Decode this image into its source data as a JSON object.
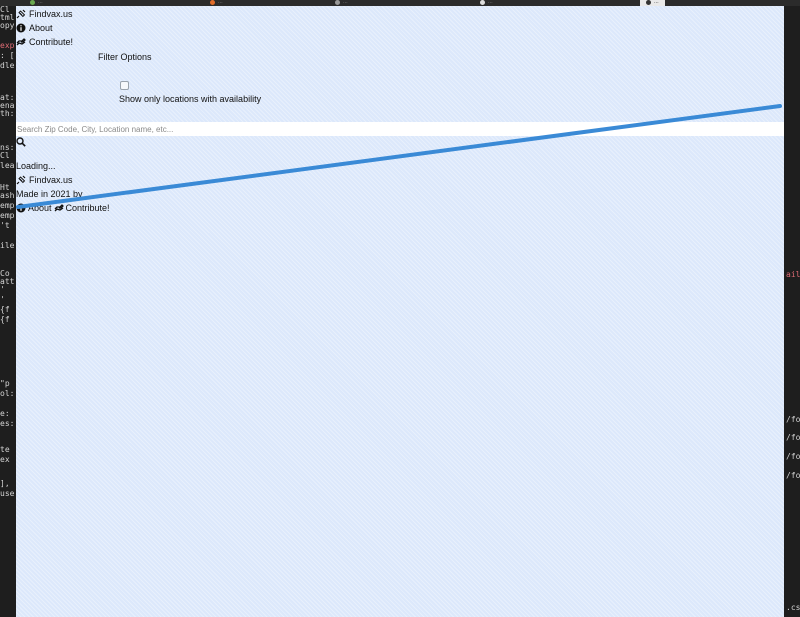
{
  "tabs": [
    {
      "label": "...",
      "active": false
    },
    {
      "label": "...",
      "active": false
    },
    {
      "label": "...",
      "active": false
    },
    {
      "label": "...",
      "active": false
    },
    {
      "label": "...",
      "active": true
    }
  ],
  "editor_left_lines": [
    "Cl",
    "tml",
    "opy",
    "",
    "exp",
    ": [",
    "dle",
    "",
    "",
    "at:",
    "ena",
    "th:",
    "",
    "",
    "ns:",
    "Cl",
    "lea",
    "",
    "Ht",
    "ash",
    "emp",
    "emp",
    "'t",
    "",
    "ile",
    "",
    "",
    "Co",
    "att",
    "'",
    "'",
    "{f",
    "{f",
    "",
    "",
    "",
    "\"p",
    "ol:",
    "",
    "e:",
    "es:",
    "",
    "te",
    "ex",
    "",
    "],",
    "use"
  ],
  "editor_right_lines": [
    "ails",
    "/for",
    "/for",
    "/for",
    "/for",
    ".css"
  ],
  "nav": {
    "brand": "Findvax.us",
    "about": "About",
    "contribute": "Contribute!"
  },
  "filter": {
    "title": "Filter Options",
    "checkbox_label": "Show only locations with availability",
    "checked": false
  },
  "search": {
    "placeholder": "Search Zip Code, City, Location name, etc..."
  },
  "status": {
    "loading": "Loading..."
  },
  "footer": {
    "brand": "Findvax.us",
    "made_in": "Made in 2021 by",
    "about": "About",
    "contribute": "Contribute!"
  },
  "icons": {
    "brand": "syringe-icon",
    "about": "info-circle-icon",
    "contribute": "hands-helping-icon",
    "search": "search-icon"
  },
  "colors": {
    "page_background": "#dce8fb",
    "overlay_stroke": "#3a8ad6",
    "editor_background": "#1e1e1e"
  }
}
